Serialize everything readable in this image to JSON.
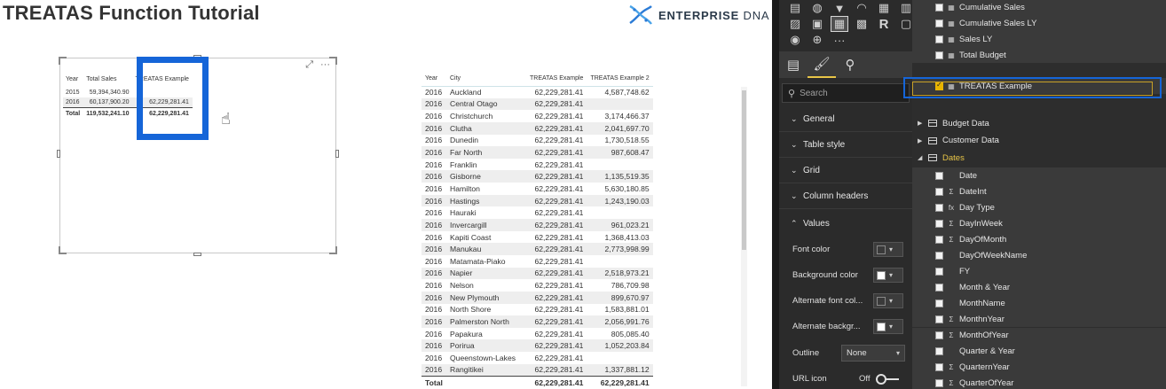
{
  "report": {
    "title": "TREATAS Function Tutorial",
    "brand_name": "ENTERPRISE",
    "brand_suffix": "DNA"
  },
  "visual1": {
    "headers": [
      "Year",
      "Total Sales",
      "TREATAS Example"
    ],
    "rows": [
      [
        "2015",
        "59,394,340.90",
        ""
      ],
      [
        "2016",
        "60,137,900.20",
        "62,229,281.41"
      ]
    ],
    "total": [
      "Total",
      "119,532,241.10",
      "62,229,281.41"
    ]
  },
  "visual2": {
    "headers": [
      "Year",
      "City",
      "TREATAS Example",
      "TREATAS Example 2"
    ],
    "rows": [
      [
        "2016",
        "Auckland",
        "62,229,281.41",
        "4,587,748.62"
      ],
      [
        "2016",
        "Central Otago",
        "62,229,281.41",
        ""
      ],
      [
        "2016",
        "Christchurch",
        "62,229,281.41",
        "3,174,466.37"
      ],
      [
        "2016",
        "Clutha",
        "62,229,281.41",
        "2,041,697.70"
      ],
      [
        "2016",
        "Dunedin",
        "62,229,281.41",
        "1,730,518.55"
      ],
      [
        "2016",
        "Far North",
        "62,229,281.41",
        "987,608.47"
      ],
      [
        "2016",
        "Franklin",
        "62,229,281.41",
        ""
      ],
      [
        "2016",
        "Gisborne",
        "62,229,281.41",
        "1,135,519.35"
      ],
      [
        "2016",
        "Hamilton",
        "62,229,281.41",
        "5,630,180.85"
      ],
      [
        "2016",
        "Hastings",
        "62,229,281.41",
        "1,243,190.03"
      ],
      [
        "2016",
        "Hauraki",
        "62,229,281.41",
        ""
      ],
      [
        "2016",
        "Invercargill",
        "62,229,281.41",
        "961,023.21"
      ],
      [
        "2016",
        "Kapiti Coast",
        "62,229,281.41",
        "1,368,413.03"
      ],
      [
        "2016",
        "Manukau",
        "62,229,281.41",
        "2,773,998.99"
      ],
      [
        "2016",
        "Matamata-Piako",
        "62,229,281.41",
        ""
      ],
      [
        "2016",
        "Napier",
        "62,229,281.41",
        "2,518,973.21"
      ],
      [
        "2016",
        "Nelson",
        "62,229,281.41",
        "786,709.98"
      ],
      [
        "2016",
        "New Plymouth",
        "62,229,281.41",
        "899,670.97"
      ],
      [
        "2016",
        "North Shore",
        "62,229,281.41",
        "1,583,881.01"
      ],
      [
        "2016",
        "Palmerston North",
        "62,229,281.41",
        "2,056,991.76"
      ],
      [
        "2016",
        "Papakura",
        "62,229,281.41",
        "805,085.40"
      ],
      [
        "2016",
        "Porirua",
        "62,229,281.41",
        "1,052,203.84"
      ],
      [
        "2016",
        "Queenstown-Lakes",
        "62,229,281.41",
        ""
      ],
      [
        "2016",
        "Rangitikei",
        "62,229,281.41",
        "1,337,881.12"
      ]
    ],
    "total": [
      "Total",
      "",
      "62,229,281.41",
      "62,229,281.41"
    ]
  },
  "format_pane": {
    "search_placeholder": "Search",
    "sections": [
      "General",
      "Table style",
      "Grid",
      "Column headers",
      "Values"
    ],
    "rows": {
      "font_color": "Font color",
      "background_color": "Background color",
      "alt_font_color": "Alternate font col...",
      "alt_background": "Alternate backgr...",
      "outline": "Outline",
      "outline_value": "None",
      "url_icon": "URL icon",
      "url_icon_state": "Off"
    },
    "swatch_colors": {
      "font": "#3a3a3a",
      "background": "#ffffff",
      "alt_font": "#3a3a3a",
      "alt_background": "#ffffff"
    }
  },
  "fields_pane": {
    "measures": [
      "Cumulative Sales",
      "Cumulative Sales LY",
      "Sales LY",
      "Total Budget",
      "TREATAS Example"
    ],
    "tables": [
      "Budget Data",
      "Customer Data",
      "Dates"
    ],
    "date_fields": [
      {
        "name": "Date",
        "icon": ""
      },
      {
        "name": "DateInt",
        "icon": "Σ"
      },
      {
        "name": "Day Type",
        "icon": "fx"
      },
      {
        "name": "DayInWeek",
        "icon": "Σ"
      },
      {
        "name": "DayOfMonth",
        "icon": "Σ"
      },
      {
        "name": "DayOfWeekName",
        "icon": ""
      },
      {
        "name": "FY",
        "icon": ""
      },
      {
        "name": "Month & Year",
        "icon": ""
      },
      {
        "name": "MonthName",
        "icon": ""
      },
      {
        "name": "MonthnYear",
        "icon": "Σ"
      },
      {
        "name": "MonthOfYear",
        "icon": "Σ"
      },
      {
        "name": "Quarter & Year",
        "icon": ""
      },
      {
        "name": "QuarternYear",
        "icon": "Σ"
      },
      {
        "name": "QuarterOfYear",
        "icon": "Σ"
      }
    ]
  },
  "colors": {
    "highlight_blue": "#1565d8",
    "accent_yellow": "#e8b400"
  }
}
